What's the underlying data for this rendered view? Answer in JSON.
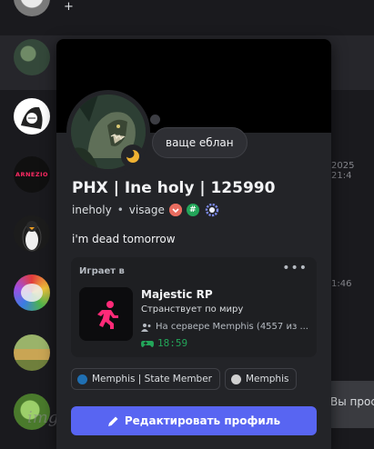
{
  "background": {
    "plus_label": "+",
    "timestamp_1": "2025 21:4",
    "timestamp_2": "1:46",
    "side_button_label": "Вы прос",
    "watermark": "imgenela",
    "avatar_logo_text": "ARNEZIO"
  },
  "profile": {
    "status_bubble": "ваще еблан",
    "display_name": "PHX | Ine holy | 125990",
    "username": "ineholy",
    "separator": "•",
    "pronouns": "visage",
    "bio": "i'm dead tomorrow",
    "status": "idle",
    "status_color": "#f0b232",
    "badges": [
      "red-heart-badge",
      "green-hash-badge",
      "gear-badge"
    ]
  },
  "activity": {
    "heading": "Играет в",
    "more_label": "•••",
    "game_title": "Majestic RP",
    "state": "Странствует по миру",
    "server": "На сервере Memphis (4557 из ...",
    "elapsed": "18:59",
    "icon_color": "#ff2a78"
  },
  "roles": [
    {
      "label": "Memphis | State Member",
      "color": "#1f6fb2"
    },
    {
      "label": "Memphis",
      "color": "#d0d0d0"
    }
  ],
  "actions": {
    "edit_profile_label": "Редактировать профиль",
    "accent": "#5865f2"
  }
}
